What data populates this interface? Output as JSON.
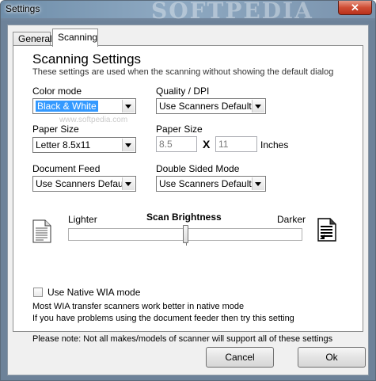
{
  "window": {
    "title": "Settings",
    "watermark": "SOFTPEDIA",
    "close_label": "✕"
  },
  "tabs": [
    {
      "label": "General",
      "active": false
    },
    {
      "label": "Scanning",
      "active": true
    }
  ],
  "header": {
    "title": "Scanning Settings",
    "subtitle": "These settings are used when the scanning without showing the default dialog"
  },
  "fields": {
    "color_mode": {
      "label": "Color mode",
      "value": "Black & White"
    },
    "quality": {
      "label": "Quality / DPI",
      "value": "Use Scanners Default"
    },
    "paper_size_combo": {
      "label": "Paper Size",
      "value": "Letter  8.5x11"
    },
    "paper_size_custom": {
      "label": "Paper Size",
      "width": "8.5",
      "height": "11",
      "times": "X",
      "units": "Inches"
    },
    "document_feed": {
      "label": "Document Feed",
      "value": "Use Scanners Default"
    },
    "double_sided": {
      "label": "Double Sided Mode",
      "value": "Use Scanners Default"
    }
  },
  "brightness": {
    "title": "Scan Brightness",
    "min_label": "Lighter",
    "max_label": "Darker",
    "level": 0.5
  },
  "wia": {
    "checkbox_label": "Use Native WIA mode",
    "checked": false,
    "note_line1": "Most WIA transfer scanners work better in native mode",
    "note_line2": "If you have problems using the document feeder then try this setting"
  },
  "please_note": "Please note:  Not all makes/models of scanner will support all of these settings",
  "buttons": {
    "cancel": "Cancel",
    "ok": "Ok"
  },
  "watermark_small": "www.softpedia.com",
  "colors": {
    "titlebar": "#7a93ad",
    "selection": "#3399ff",
    "close": "#c8452c"
  }
}
